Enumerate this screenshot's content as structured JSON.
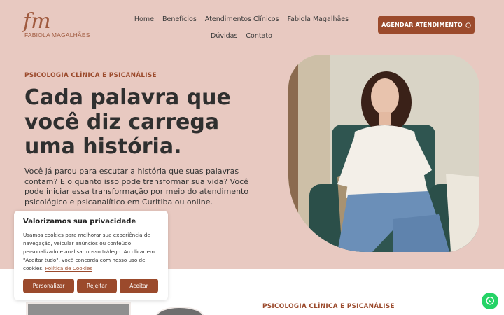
{
  "brand": {
    "monogram": "fm",
    "name": "FABIOLA MAGALHÃES"
  },
  "nav": [
    {
      "label": "Home"
    },
    {
      "label": "Benefícios"
    },
    {
      "label": "Atendimentos Clínicos"
    },
    {
      "label": "Fabiola Magalhães"
    },
    {
      "label": "Dúvidas"
    },
    {
      "label": "Contato"
    }
  ],
  "header": {
    "cta_label": "AGENDAR ATENDIMENTO"
  },
  "hero": {
    "eyebrow": "PSICOLOGIA CLÍNICA E PSICANÁLISE",
    "headline": "Cada palavra que você diz carrega uma história.",
    "intro": "Você já parou para escutar a história que suas palavras contam? E o quanto isso pode transformar sua vida? Você pode iniciar essa transformação por meio do atendimento psicológico e psicanalítico em Curitiba ou online."
  },
  "section2": {
    "eyebrow": "PSICOLOGIA CLÍNICA E PSICANÁLISE"
  },
  "cookie": {
    "title": "Valorizamos sua privacidade",
    "text": "Usamos cookies para melhorar sua experiência de navegação, veicular anúncios ou conteúdo personalizado e analisar nosso tráfego. Ao clicar em \"Aceitar tudo\", você concorda com nosso uso de cookies.",
    "policy_link": "Política de Cookies",
    "btn_customize": "Personalizar",
    "btn_reject": "Rejeitar",
    "btn_accept": "Aceitar"
  },
  "colors": {
    "accent": "#9b4a2c",
    "background": "#e8c9c1",
    "whatsapp": "#25d366"
  },
  "icons": {
    "whatsapp": "whatsapp-icon"
  }
}
